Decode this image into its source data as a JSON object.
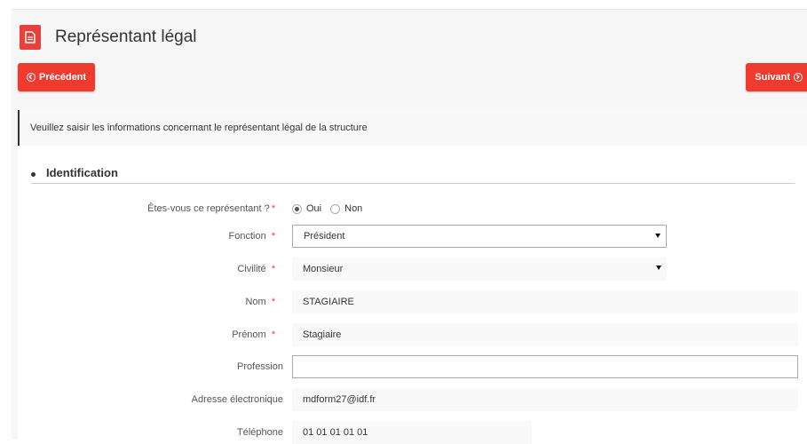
{
  "header": {
    "title": "Représentant légal",
    "icon": "document-icon"
  },
  "nav": {
    "prev_label": "Précédent",
    "next_label": "Suivant"
  },
  "info_text": "Veuillez saisir les informations concernant le représentant légal de la structure",
  "section": {
    "title": "Identification"
  },
  "required_mark": "*",
  "form": {
    "representant": {
      "label": "Êtes-vous ce représentant ?",
      "options": [
        "Oui",
        "Non"
      ],
      "selected": "Oui"
    },
    "fonction": {
      "label": "Fonction",
      "value": "Président"
    },
    "civilite": {
      "label": "Civilité",
      "value": "Monsieur"
    },
    "nom": {
      "label": "Nom",
      "value": "STAGIAIRE"
    },
    "prenom": {
      "label": "Prénom",
      "value": "Stagiaire"
    },
    "profession": {
      "label": "Profession",
      "value": ""
    },
    "email": {
      "label": "Adresse électronique",
      "value": "mdform27@idf.fr"
    },
    "telephone": {
      "label": "Téléphone",
      "value": "01 01 01 01 01"
    }
  },
  "colors": {
    "accent": "#ee3a2f",
    "header_icon": "#e8413b"
  }
}
